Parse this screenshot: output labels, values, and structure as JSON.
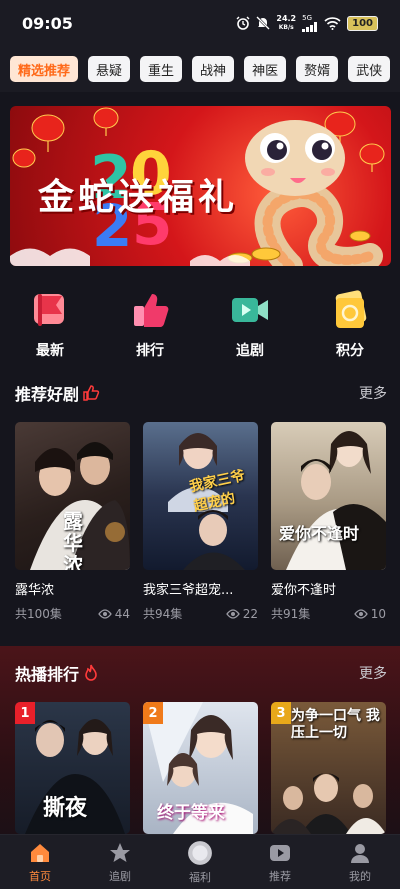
{
  "status": {
    "time": "09:05",
    "net_speed_value": "24.2",
    "net_speed_unit": "KB/s",
    "signal_label": "5G",
    "battery": "100",
    "icons": [
      "alarm-icon",
      "mute-icon",
      "signal-icon",
      "wifi-icon",
      "battery-icon"
    ]
  },
  "tabs": [
    {
      "label": "精选推荐",
      "active": true
    },
    {
      "label": "悬疑"
    },
    {
      "label": "重生"
    },
    {
      "label": "战神"
    },
    {
      "label": "神医"
    },
    {
      "label": "赘婿"
    },
    {
      "label": "武侠"
    }
  ],
  "banner": {
    "text": "金蛇送福礼",
    "year_digits": "2025"
  },
  "quick": [
    {
      "label": "最新",
      "icon": "flag-icon"
    },
    {
      "label": "排行",
      "icon": "thumbs-up-icon"
    },
    {
      "label": "追剧",
      "icon": "video-icon"
    },
    {
      "label": "积分",
      "icon": "coin-card-icon"
    }
  ],
  "recommend": {
    "title": "推荐好剧",
    "more": "更多",
    "items": [
      {
        "title": "露华浓",
        "episodes": "共100集",
        "views": "44",
        "poster_text": "露华浓"
      },
      {
        "title": "我家三爷超宠妻",
        "title_display": "我家三爷超宠...",
        "episodes": "共94集",
        "views": "22",
        "poster_text": "我家三爷超宠的"
      },
      {
        "title": "爱你不逢时",
        "episodes": "共91集",
        "views": "10",
        "poster_text": "爱你不逢时"
      }
    ]
  },
  "hot": {
    "title": "热播排行",
    "more": "更多",
    "items": [
      {
        "rank": "1",
        "poster_text": "撕夜"
      },
      {
        "rank": "2",
        "poster_text": "终于等来"
      },
      {
        "rank": "3",
        "poster_text": "为争一口气 我压上一切"
      }
    ]
  },
  "nav": [
    {
      "label": "首页",
      "icon": "home-icon",
      "active": true
    },
    {
      "label": "追剧",
      "icon": "star-icon"
    },
    {
      "label": "福利",
      "icon": "gift-icon"
    },
    {
      "label": "推荐",
      "icon": "play-icon"
    },
    {
      "label": "我的",
      "icon": "user-icon"
    }
  ],
  "colors": {
    "accent": "#ff6a1a",
    "background": "#15151d",
    "hot_bg": "#4b1419"
  }
}
